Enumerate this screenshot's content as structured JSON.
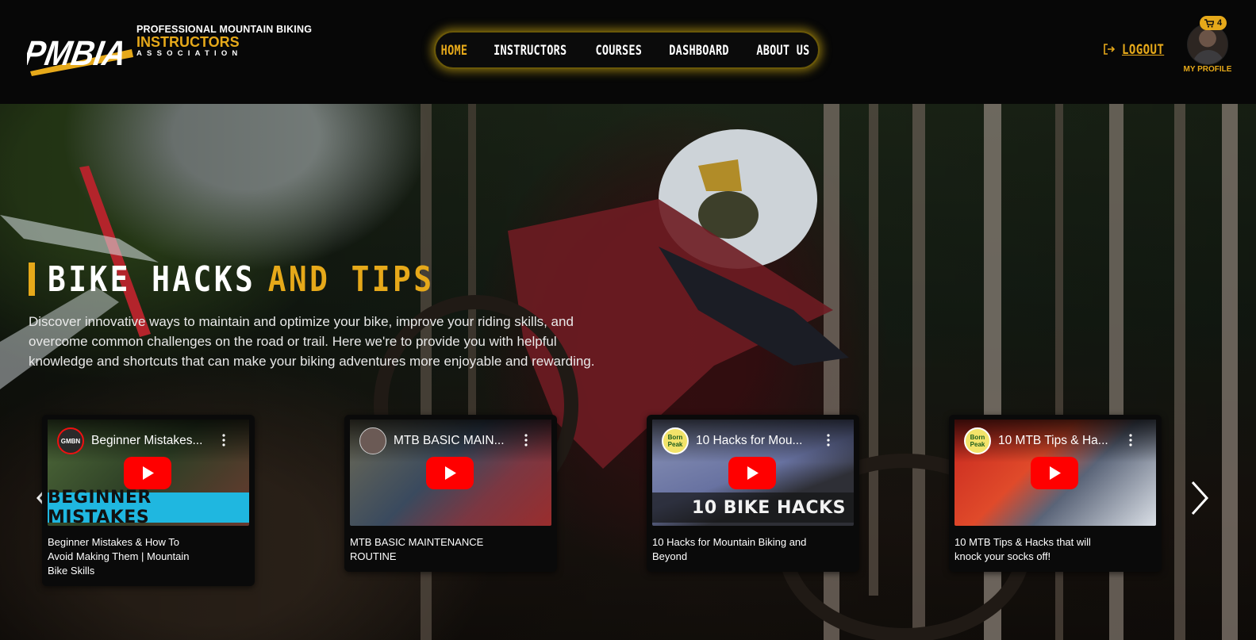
{
  "header": {
    "logo": {
      "mark_text": "PMBIA",
      "line1": "PROFESSIONAL MOUNTAIN BIKING",
      "line2": "INSTRUCTORS",
      "line3": "ASSOCIATION"
    },
    "nav": [
      {
        "label": "HOME",
        "active": true
      },
      {
        "label": "INSTRUCTORS",
        "active": false
      },
      {
        "label": "COURSES",
        "active": false
      },
      {
        "label": "DASHBOARD",
        "active": false
      },
      {
        "label": "ABOUT US",
        "active": false
      }
    ],
    "logout_label": "LOGOUT",
    "cart_count": "4",
    "profile_label": "MY PROFILE"
  },
  "hero": {
    "title_white": "BIKE HACKS",
    "title_yellow": "AND TIPS",
    "description": "Discover innovative ways to maintain and optimize your bike, improve your riding skills, and overcome common challenges on the road or trail. Here we're to provide you with helpful knowledge and shortcuts that can make your biking adventures more enjoyable and rewarding."
  },
  "videos": [
    {
      "channel": "GMBN",
      "overlay_title": "Beginner Mistakes...",
      "banner": "BEGINNER MISTAKES",
      "caption": "Beginner Mistakes & How To Avoid Making Them | Mountain Bike Skills"
    },
    {
      "channel": "",
      "overlay_title": "MTB BASIC MAIN...",
      "banner": "",
      "caption": "MTB BASIC MAINTENANCE ROUTINE"
    },
    {
      "channel": "Born Peak",
      "overlay_title": "10 Hacks for Mou...",
      "banner": "10 BIKE HACKS",
      "caption": "10 Hacks for Mountain Biking and Beyond"
    },
    {
      "channel": "Born Peak",
      "overlay_title": "10 MTB Tips & Ha...",
      "banner": "",
      "caption": "10 MTB Tips & Hacks that will knock your socks off!"
    }
  ],
  "colors": {
    "accent": "#e6a91a",
    "youtube_red": "#ff0000",
    "background": "#070707"
  },
  "icons": [
    "logout-icon",
    "cart-icon",
    "play-icon",
    "chevron-left-icon",
    "chevron-right-icon",
    "kebab-menu-icon"
  ]
}
